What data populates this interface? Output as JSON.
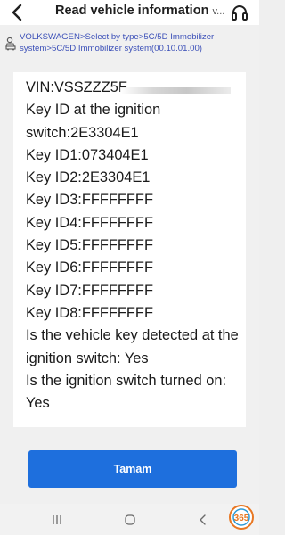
{
  "header": {
    "title": "Read vehicle information",
    "title_ellipsis": "v...",
    "back_icon": "back-chevron-icon",
    "support_icon": "headset-icon"
  },
  "breadcrumb": {
    "icon": "car-diagnostic-icon",
    "text": "VOLKSWAGEN>Select by type>5C/5D Immobilizer system>5C/5D Immobilizer system(00.10.01.00)"
  },
  "info": {
    "vin": "VIN:VSSZZZ5F",
    "lines": [
      "Key ID at the ignition switch:2E3304E1",
      "Key ID1:073404E1",
      "Key ID2:2E3304E1",
      "Key ID3:FFFFFFFF",
      "Key ID4:FFFFFFFF",
      "Key ID5:FFFFFFFF",
      "Key ID6:FFFFFFFF",
      "Key ID7:FFFFFFFF",
      "Key ID8:FFFFFFFF",
      "Is the vehicle key detected at the ignition switch: Yes",
      "Is the ignition switch turned on: Yes"
    ]
  },
  "actions": {
    "ok_label": "Tamam"
  },
  "navbar": {
    "recent_icon": "recent-apps-icon",
    "home_icon": "home-icon",
    "back_icon": "back-icon"
  },
  "watermark": {
    "text": "365"
  },
  "colors": {
    "accent": "#1e6fdd",
    "link": "#3c50b8",
    "background": "#f0f0f0"
  }
}
